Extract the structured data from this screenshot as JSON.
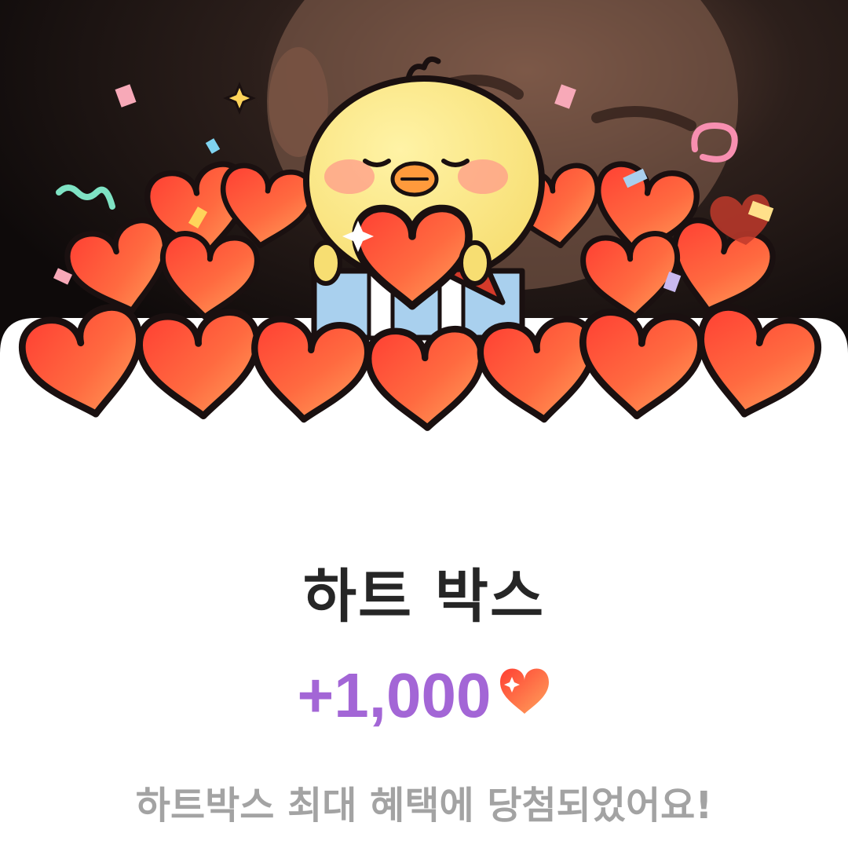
{
  "popup": {
    "title": "하트 박스",
    "reward_amount": "+1,000",
    "reward_icon": "heart-icon",
    "message": "하트박스 최대 혜택에 당첨되었어요!"
  },
  "illustration": {
    "character": "yellow-chick",
    "object": "heart-gift-box",
    "decorations": "confetti"
  },
  "colors": {
    "amount": "#a366d6",
    "title": "#262626",
    "message": "#a3a3a3",
    "heart": "#ff5a3c",
    "background": "#ffffff"
  }
}
